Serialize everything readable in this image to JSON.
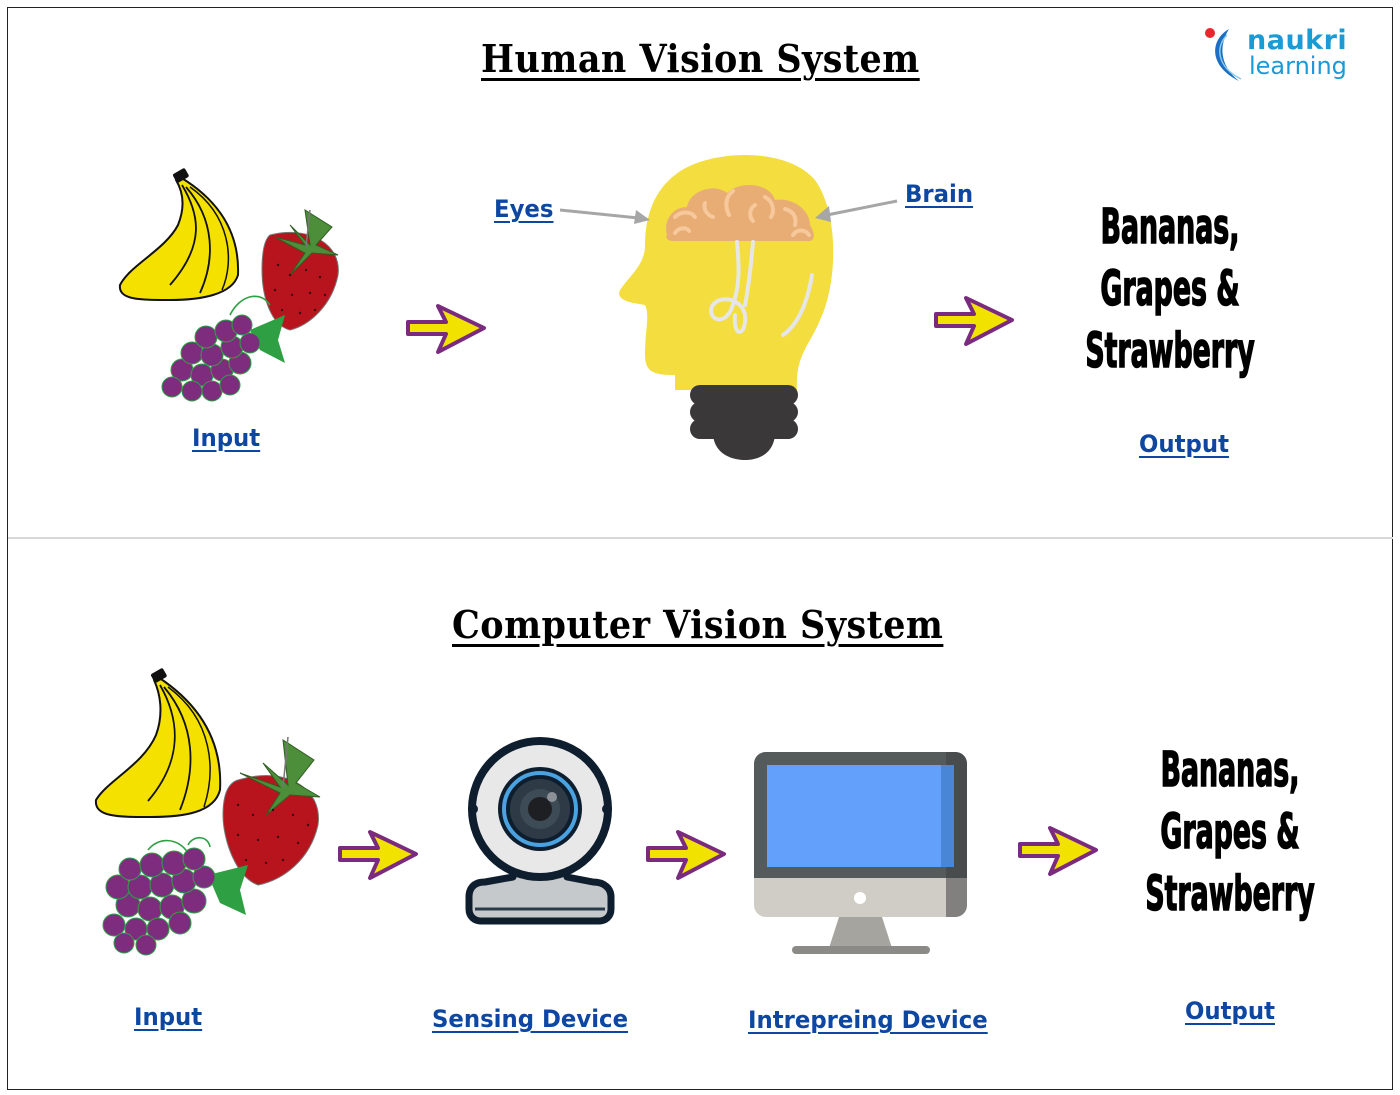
{
  "logo": {
    "line1": "naukri",
    "line2": "learning",
    "brand_color": "#1b9ad6",
    "dot_color": "#e8262d"
  },
  "human": {
    "title": "Human Vision System",
    "input_label": "Input",
    "eyes_label": "Eyes",
    "brain_label": "Brain",
    "output_lines": [
      "Bananas,",
      "Grapes &",
      "Strawberry"
    ],
    "output_label": "Output"
  },
  "computer": {
    "title": "Computer Vision System",
    "input_label": "Input",
    "sensing_label": "Sensing Device",
    "interpreting_label": "Intrepreing Device",
    "output_lines": [
      "Bananas,",
      "Grapes &",
      "Strawberry"
    ],
    "output_label": "Output"
  },
  "colors": {
    "link": "#0d47a1",
    "arrow_fill": "#f2e200",
    "arrow_stroke": "#7a2a7f",
    "head_yellow": "#f3dd3f",
    "brain": "#e8ad74",
    "screen": "#62a0fb"
  }
}
